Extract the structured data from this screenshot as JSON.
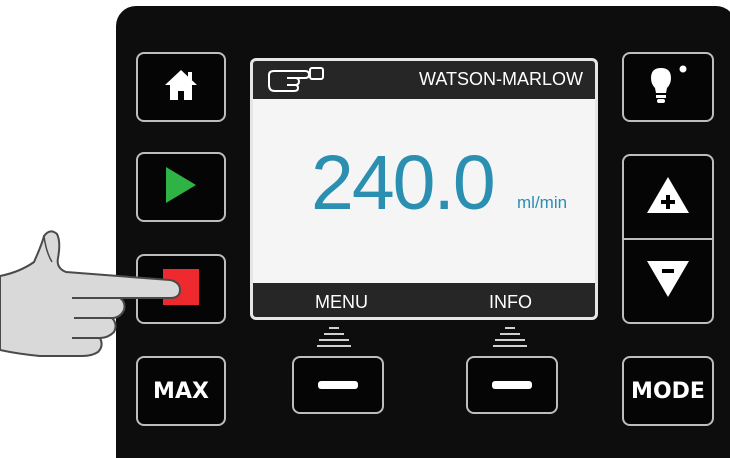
{
  "screen": {
    "brand": "WATSON-MARLOW",
    "flow_value": "240.0",
    "flow_unit": "ml/min",
    "softkey_left_label": "MENU",
    "softkey_right_label": "INFO"
  },
  "buttons": {
    "max_label": "MAX",
    "mode_label": "MODE"
  },
  "icons": {
    "home": "home-icon",
    "start": "play-icon",
    "stop": "stop-icon",
    "keypad": "hand-pointer-icon",
    "light": "lightbulb-icon",
    "increase": "plus-triangle-icon",
    "decrease": "minus-triangle-icon",
    "hand": "pointing-hand-icon"
  },
  "colors": {
    "play": "#2fb344",
    "stop": "#ee2a2f",
    "display_value": "#2a8fb1"
  }
}
